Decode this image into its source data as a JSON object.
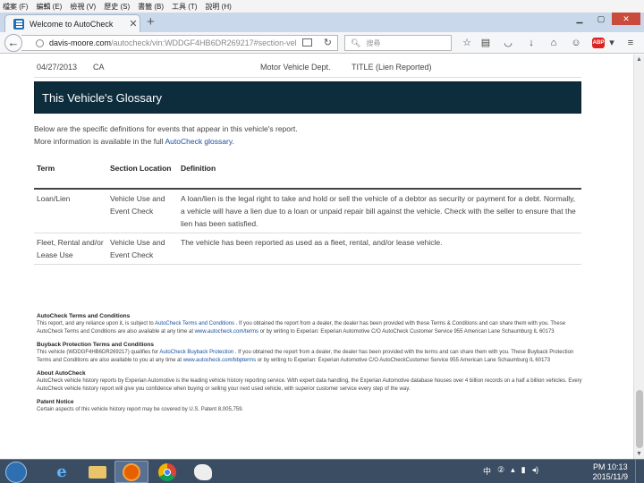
{
  "browser": {
    "menu": [
      "檔案 (F)",
      "編輯 (E)",
      "檢視 (V)",
      "歷史 (S)",
      "書籤 (B)",
      "工具 (T)",
      "說明 (H)"
    ],
    "tab_title": "Welcome to AutoCheck",
    "url_host": "davis-moore.com",
    "url_path": "/autocheck/vin:WDDGF4HB6DR269217#section-vel",
    "search_placeholder": "搜尋",
    "abp_label": "ABP"
  },
  "page": {
    "prev_row": {
      "date": "04/27/2013",
      "state": "CA",
      "source": "Motor Vehicle Dept.",
      "event": "TITLE (Lien Reported)"
    },
    "glossary_title": "This Vehicle's Glossary",
    "intro_line1": "Below are the specific definitions for events that appear in this vehicle's report.",
    "intro_line2_prefix": "More information is available in the full",
    "intro_link": "AutoCheck glossary",
    "intro_line2_suffix": ".",
    "table": {
      "headers": {
        "term": "Term",
        "location": "Section Location",
        "definition": "Definition"
      },
      "rows": [
        {
          "term": "Loan/Lien",
          "location": "Vehicle Use and Event Check",
          "definition": "A loan/lien is the legal right to take and hold or sell the vehicle of a debtor as security or payment for a debt. Normally, a vehicle will have a lien due to a loan or unpaid repair bill against the vehicle. Check with the seller to ensure that the lien has been satisfied."
        },
        {
          "term": "Fleet, Rental and/or Lease Use",
          "location": "Vehicle Use and Event Check",
          "definition": "The vehicle has been reported as used as a fleet, rental, and/or lease vehicle."
        }
      ]
    },
    "footer": {
      "terms_title": "AutoCheck Terms and Conditions",
      "terms_a": "This report, and any reliance upon it, is subject to",
      "terms_link": "AutoCheck Terms and Conditions",
      "terms_b": ". If you obtained the report from a dealer, the dealer has been provided with these Terms & Conditions and can share them with you. These AutoCheck Terms and Conditions are also available at any time at",
      "terms_url": "www.autocheck.com/terms",
      "terms_c": "or by writing to Experian: Experian Automotive C/O AutoCheck Customer Service 955 American Lane Schaumburg IL 60173",
      "buyback_title": "Buyback Protection Terms and Conditions",
      "buyback_a": "This vehicle (WDDGF4HB6DR269217) qualifies for",
      "buyback_link": "AutoCheck Buyback Protection",
      "buyback_b": ". If you obtained the report from a dealer, the dealer has been provided with the terms and can share them with you. These Buyback Protection Terms and Conditions are also available to you at any time at",
      "buyback_url": "www.autocheck.com/bbpterms",
      "buyback_c": "or by writing to Experian: Experian Automotive C/O AutoCheckCustomer Service 955 American Lane Schaumburg IL 60173",
      "about_title": "About AutoCheck",
      "about_text": "AutoCheck vehicle history reports by Experian Automotive is the leading vehicle history reporting service. With expert data handling, the Experian Automotive database houses over 4 billion records on a half a billion vehicles. Every AutoCheck vehicle history report will give you confidence when buying or selling your next used vehicle, with superior customer service every step of the way.",
      "patent_title": "Patent Notice",
      "patent_text": "Certain aspects of this vehicle history report may be covered by U.S. Patent 8,005,759."
    }
  },
  "taskbar": {
    "time": "PM 10:13",
    "date": "2015/11/9"
  },
  "colors": {
    "banner": "#0d2d3d",
    "link": "#1a4fa0",
    "taskbar": "#3b4d63"
  }
}
